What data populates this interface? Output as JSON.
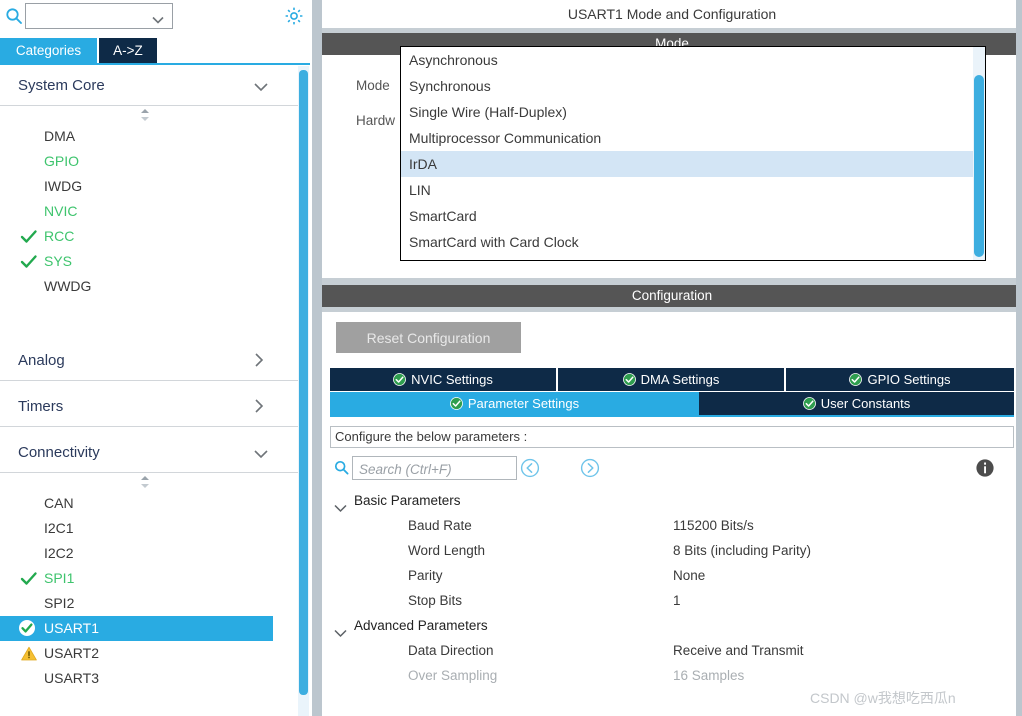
{
  "app": {
    "watermark": "CSDN @w我想吃西瓜n"
  },
  "left_panel": {
    "search": {
      "value": "",
      "placeholder": "",
      "icon": "search-icon"
    },
    "gear_icon": "gear-icon",
    "tabs": [
      {
        "label": "Categories",
        "active": true
      },
      {
        "label": "A->Z",
        "active": false
      }
    ],
    "groups": [
      {
        "name": "System Core",
        "expanded": true,
        "items": [
          {
            "label": "DMA",
            "state": "none"
          },
          {
            "label": "GPIO",
            "state": "green"
          },
          {
            "label": "IWDG",
            "state": "none"
          },
          {
            "label": "NVIC",
            "state": "green"
          },
          {
            "label": "RCC",
            "state": "check"
          },
          {
            "label": "SYS",
            "state": "check"
          },
          {
            "label": "WWDG",
            "state": "none"
          }
        ]
      },
      {
        "name": "Analog",
        "expanded": false,
        "items": []
      },
      {
        "name": "Timers",
        "expanded": false,
        "items": []
      },
      {
        "name": "Connectivity",
        "expanded": true,
        "items": [
          {
            "label": "CAN",
            "state": "none"
          },
          {
            "label": "I2C1",
            "state": "none"
          },
          {
            "label": "I2C2",
            "state": "none"
          },
          {
            "label": "SPI1",
            "state": "check"
          },
          {
            "label": "SPI2",
            "state": "none"
          },
          {
            "label": "USART1",
            "state": "selected"
          },
          {
            "label": "USART2",
            "state": "warning"
          },
          {
            "label": "USART3",
            "state": "none"
          }
        ]
      }
    ]
  },
  "right_panel": {
    "title": "USART1 Mode and Configuration",
    "mode_section_label": "Mode",
    "config_section_label": "Configuration",
    "mode_field": {
      "label": "Mode",
      "value": "Asynchronous"
    },
    "hardware_field": {
      "label": "Hardw"
    },
    "dropdown": {
      "open": true,
      "highlighted": "IrDA",
      "options": [
        "Asynchronous",
        "Synchronous",
        "Single Wire (Half-Duplex)",
        "Multiprocessor Communication",
        "IrDA",
        "LIN",
        "SmartCard",
        "SmartCard with Card Clock"
      ]
    },
    "reset_button": "Reset Configuration",
    "config_tabs_row1": [
      {
        "label": "NVIC Settings",
        "active": false,
        "icon": "green-check-icon"
      },
      {
        "label": "DMA Settings",
        "active": false,
        "icon": "green-check-icon"
      },
      {
        "label": "GPIO Settings",
        "active": false,
        "icon": "green-check-icon"
      }
    ],
    "config_tabs_row2": [
      {
        "label": "Parameter Settings",
        "active": true,
        "icon": "green-check-icon"
      },
      {
        "label": "User Constants",
        "active": false,
        "icon": "green-check-icon"
      }
    ],
    "configure_strip": "Configure the below parameters :",
    "param_search": {
      "placeholder": "Search (Ctrl+F)",
      "value": "",
      "icon": "search-icon",
      "prev_icon": "chevron-left-circle-icon",
      "next_icon": "chevron-right-circle-icon",
      "info_icon": "info-icon"
    },
    "param_groups": [
      {
        "name": "Basic Parameters",
        "expanded": true,
        "rows": [
          {
            "name": "Baud Rate",
            "value": "115200 Bits/s",
            "disabled": false
          },
          {
            "name": "Word Length",
            "value": "8 Bits (including Parity)",
            "disabled": false
          },
          {
            "name": "Parity",
            "value": "None",
            "disabled": false
          },
          {
            "name": "Stop Bits",
            "value": "1",
            "disabled": false
          }
        ]
      },
      {
        "name": "Advanced Parameters",
        "expanded": true,
        "rows": [
          {
            "name": "Data Direction",
            "value": "Receive and Transmit",
            "disabled": false
          },
          {
            "name": "Over Sampling",
            "value": "16 Samples",
            "disabled": true
          }
        ]
      }
    ]
  },
  "colors": {
    "accent_blue": "#29abe2",
    "navy": "#0e2a47",
    "green": "#3ec46d",
    "warning_amber": "#f5c033",
    "section_grey": "#555555"
  }
}
